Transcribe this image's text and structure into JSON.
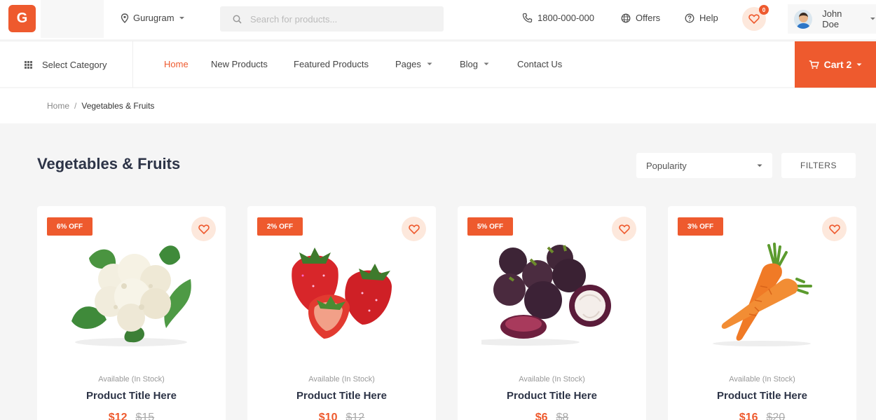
{
  "brand": {
    "logo_letter": "G"
  },
  "header": {
    "location": "Gurugram",
    "search_placeholder": "Search for products...",
    "phone": "1800-000-000",
    "offers_label": "Offers",
    "help_label": "Help",
    "wishlist_count": "0",
    "user_name": "John Doe"
  },
  "nav": {
    "category_label": "Select Category",
    "items": [
      {
        "label": "Home",
        "active": true
      },
      {
        "label": "New Products"
      },
      {
        "label": "Featured Products"
      },
      {
        "label": "Pages"
      },
      {
        "label": "Blog"
      },
      {
        "label": "Contact Us"
      }
    ],
    "cart_label": "Cart 2"
  },
  "breadcrumb": {
    "home": "Home",
    "separator": "/",
    "current": "Vegetables & Fruits"
  },
  "listing": {
    "title": "Vegetables & Fruits",
    "sort_value": "Popularity",
    "filters_label": "FILTERS"
  },
  "products": [
    {
      "discount": "6% OFF",
      "image": "cauliflower",
      "availability": "Available (In Stock)",
      "title": "Product Title Here",
      "price": "$12",
      "mrp": "$15"
    },
    {
      "discount": "2% OFF",
      "image": "strawberries",
      "availability": "Available (In Stock)",
      "title": "Product Title Here",
      "price": "$10",
      "mrp": "$12"
    },
    {
      "discount": "5% OFF",
      "image": "mangosteen",
      "availability": "Available (In Stock)",
      "title": "Product Title Here",
      "price": "$6",
      "mrp": "$8"
    },
    {
      "discount": "3% OFF",
      "image": "carrots",
      "availability": "Available (In Stock)",
      "title": "Product Title Here",
      "price": "$16",
      "mrp": "$20"
    }
  ],
  "colors": {
    "accent": "#ee5a2e",
    "accent_light": "#fde8dc",
    "title": "#2d3447"
  }
}
